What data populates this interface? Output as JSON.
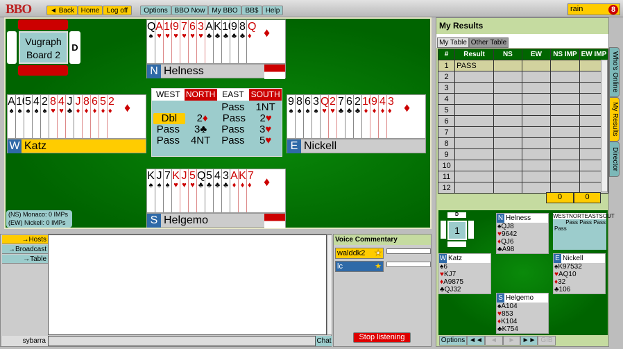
{
  "topbar": {
    "logo": "BBO",
    "buttons": [
      "◄ Back",
      "Home",
      "Log off"
    ],
    "menu": [
      "Options",
      "BBO Now",
      "My BBO",
      "BB$",
      "Help"
    ],
    "user": "rain",
    "badge": "8"
  },
  "board": {
    "title": "Vugraph Board 2",
    "dealer": "D"
  },
  "hands": {
    "north": {
      "dir": "N",
      "name": "Helness",
      "cards": [
        [
          "Q",
          "♠"
        ],
        [
          "A",
          "♥"
        ],
        [
          "10",
          "♥"
        ],
        [
          "9",
          "♥"
        ],
        [
          "7",
          "♥"
        ],
        [
          "6",
          "♥"
        ],
        [
          "3",
          "♥"
        ],
        [
          "A",
          "♣"
        ],
        [
          "K",
          "♣"
        ],
        [
          "10",
          "♣"
        ],
        [
          "9",
          "♣"
        ],
        [
          "8",
          "♣"
        ],
        [
          "Q",
          "♦"
        ]
      ]
    },
    "west": {
      "dir": "W",
      "name": "Katz",
      "cards": [
        [
          "A",
          "♠"
        ],
        [
          "10",
          "♠"
        ],
        [
          "5",
          "♠"
        ],
        [
          "4",
          "♠"
        ],
        [
          "2",
          "♠"
        ],
        [
          "8",
          "♥"
        ],
        [
          "4",
          "♥"
        ],
        [
          "J",
          "♣"
        ],
        [
          "J",
          "♦"
        ],
        [
          "8",
          "♦"
        ],
        [
          "6",
          "♦"
        ],
        [
          "5",
          "♦"
        ],
        [
          "2",
          "♦"
        ]
      ]
    },
    "east": {
      "dir": "E",
      "name": "Nickell",
      "cards": [
        [
          "9",
          "♠"
        ],
        [
          "8",
          "♠"
        ],
        [
          "6",
          "♠"
        ],
        [
          "3",
          "♠"
        ],
        [
          "Q",
          "♥"
        ],
        [
          "2",
          "♥"
        ],
        [
          "7",
          "♣"
        ],
        [
          "6",
          "♣"
        ],
        [
          "2",
          "♣"
        ],
        [
          "10",
          "♦"
        ],
        [
          "9",
          "♦"
        ],
        [
          "4",
          "♦"
        ],
        [
          "3",
          "♦"
        ]
      ]
    },
    "south": {
      "dir": "S",
      "name": "Helgemo",
      "cards": [
        [
          "K",
          "♠"
        ],
        [
          "J",
          "♠"
        ],
        [
          "7",
          "♠"
        ],
        [
          "K",
          "♥"
        ],
        [
          "J",
          "♥"
        ],
        [
          "5",
          "♥"
        ],
        [
          "Q",
          "♣"
        ],
        [
          "5",
          "♣"
        ],
        [
          "4",
          "♣"
        ],
        [
          "3",
          "♣"
        ],
        [
          "A",
          "♦"
        ],
        [
          "K",
          "♦"
        ],
        [
          "7",
          "♦"
        ]
      ]
    }
  },
  "bidding": {
    "headers": [
      "WEST",
      "NORTH",
      "EAST",
      "SOUTH"
    ],
    "rows": [
      [
        "",
        "",
        "Pass",
        "1NT"
      ],
      [
        "Dbl",
        "2♦",
        "Pass",
        "2♥"
      ],
      [
        "Pass",
        "3♣",
        "Pass",
        "3♥"
      ],
      [
        "Pass",
        "4NT",
        "Pass",
        "5♥"
      ]
    ]
  },
  "score": {
    "ns": "(NS) Monaco:  0 IMPs",
    "ew": "(EW) Nickell:   0 IMPs"
  },
  "results": {
    "title": "My Results",
    "tabs": [
      "My Table",
      "Other Table"
    ],
    "columns": [
      "#",
      "Result",
      "NS",
      "EW",
      "NS IMP",
      "EW IMP"
    ],
    "rows": [
      [
        "1",
        "PASS"
      ],
      [
        "2",
        ""
      ],
      [
        "3",
        ""
      ],
      [
        "4",
        ""
      ],
      [
        "5",
        ""
      ],
      [
        "6",
        ""
      ],
      [
        "7",
        ""
      ],
      [
        "8",
        ""
      ],
      [
        "9",
        ""
      ],
      [
        "10",
        ""
      ],
      [
        "11",
        ""
      ],
      [
        "12",
        ""
      ]
    ],
    "totals": [
      "0",
      "0"
    ]
  },
  "side_tabs": [
    "Who's Online",
    "My Results",
    "Director"
  ],
  "mini": {
    "dealer": "D",
    "board": "1",
    "bid_headers": [
      "WEST",
      "NORT",
      "EAST",
      "SOUT"
    ],
    "bids": "Pass Pass Pass",
    "bids2": "Pass",
    "hands": [
      {
        "dir": "N",
        "name": "Helness",
        "s": "QJ8",
        "h": "9642",
        "d": "QJ6",
        "c": "A98"
      },
      {
        "dir": "W",
        "name": "Katz",
        "s": "6",
        "h": "KJ7",
        "d": "A9875",
        "c": "QJ32"
      },
      {
        "dir": "E",
        "name": "Nickell",
        "s": "K97532",
        "h": "AQ10",
        "d": "32",
        "c": "106"
      },
      {
        "dir": "S",
        "name": "Helgemo",
        "s": "A104",
        "h": "853",
        "d": "K104",
        "c": "K754"
      }
    ],
    "buttons": [
      "Options",
      "◄◄",
      "◄",
      "►",
      "►►",
      "GIB"
    ]
  },
  "chat": {
    "targets": [
      "→Hosts",
      "→Broadcast",
      "→Table"
    ],
    "user": "sybarra",
    "send": "Chat"
  },
  "voice": {
    "title": "Voice Commentary",
    "users": [
      "walddk2",
      "lc"
    ],
    "stop": "Stop listening"
  }
}
